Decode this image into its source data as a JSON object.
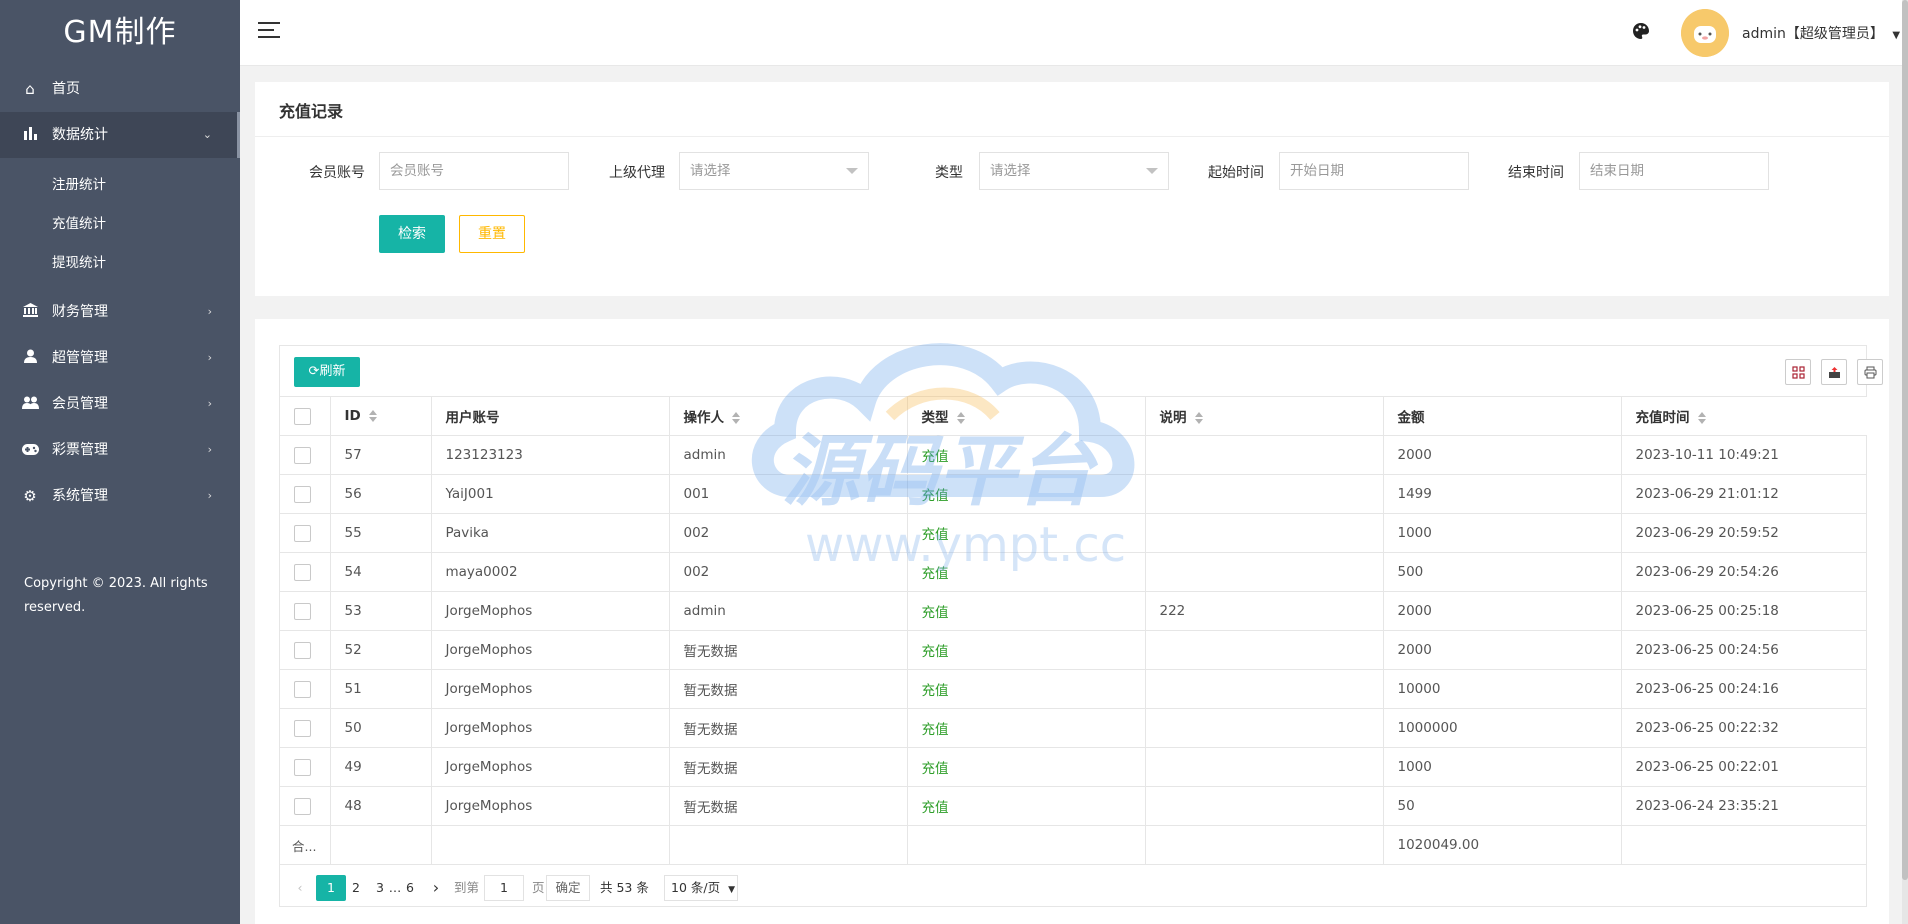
{
  "app": {
    "logo": "GM制作",
    "copyright": "Copyright © 2023. All rights reserved."
  },
  "sidebar": {
    "items": [
      {
        "label": "首页",
        "icon": "home-icon"
      },
      {
        "label": "数据统计",
        "icon": "bar-chart-icon",
        "expanded": true,
        "children": [
          "注册统计",
          "充值统计",
          "提现统计"
        ]
      },
      {
        "label": "财务管理",
        "icon": "bank-icon"
      },
      {
        "label": "超管管理",
        "icon": "user-icon"
      },
      {
        "label": "会员管理",
        "icon": "users-icon"
      },
      {
        "label": "彩票管理",
        "icon": "gamepad-icon"
      },
      {
        "label": "系统管理",
        "icon": "gear-icon"
      }
    ]
  },
  "header": {
    "user": "admin【超级管理员】",
    "icons": [
      "menu-icon",
      "palette-icon",
      "avatar"
    ]
  },
  "filter": {
    "title": "充值记录",
    "fields": [
      {
        "label": "会员账号",
        "placeholder": "会员账号"
      },
      {
        "label": "上级代理",
        "placeholder": "请选择"
      },
      {
        "label": "类型",
        "placeholder": "请选择"
      },
      {
        "label": "起始时间",
        "placeholder": "开始日期"
      },
      {
        "label": "结束时间",
        "placeholder": "结束日期"
      }
    ],
    "search_label": "检索",
    "reset_label": "重置"
  },
  "table": {
    "refresh_label": "刷新",
    "toolbar_icons": [
      "columns-icon",
      "export-icon",
      "print-icon"
    ],
    "columns": [
      "ID",
      "用户账号",
      "操作人",
      "类型",
      "说明",
      "金额",
      "充值时间"
    ],
    "rows": [
      [
        "57",
        "123123123",
        "admin",
        "充值",
        "",
        "2000",
        "2023-10-11 10:49:21"
      ],
      [
        "56",
        "YaiJ001",
        "001",
        "充值",
        "",
        "1499",
        "2023-06-29 21:01:12"
      ],
      [
        "55",
        "Pavika",
        "002",
        "充值",
        "",
        "1000",
        "2023-06-29 20:59:52"
      ],
      [
        "54",
        "maya0002",
        "002",
        "充值",
        "",
        "500",
        "2023-06-29 20:54:26"
      ],
      [
        "53",
        "JorgeMophos",
        "admin",
        "充值",
        "222",
        "2000",
        "2023-06-25 00:25:18"
      ],
      [
        "52",
        "JorgeMophos",
        "暂无数据",
        "充值",
        "",
        "2000",
        "2023-06-25 00:24:56"
      ],
      [
        "51",
        "JorgeMophos",
        "暂无数据",
        "充值",
        "",
        "10000",
        "2023-06-25 00:24:16"
      ],
      [
        "50",
        "JorgeMophos",
        "暂无数据",
        "充值",
        "",
        "1000000",
        "2023-06-25 00:22:32"
      ],
      [
        "49",
        "JorgeMophos",
        "暂无数据",
        "充值",
        "",
        "1000",
        "2023-06-25 00:22:01"
      ],
      [
        "48",
        "JorgeMophos",
        "暂无数据",
        "充值",
        "",
        "50",
        "2023-06-24 23:35:21"
      ]
    ],
    "total_label": "合...",
    "total_amount": "1020049.00"
  },
  "pagination": {
    "pages": [
      "1",
      "2",
      "3",
      "…",
      "6"
    ],
    "current": "1",
    "goto_label": "到第",
    "goto_value": "1",
    "page_unit": "页",
    "confirm_label": "确定",
    "total_text": "共 53 条",
    "page_size": "10 条/页"
  },
  "watermark": {
    "title": "源码平台",
    "url": "www.ympt.cc"
  },
  "colors": {
    "sidebar": "#4a5466",
    "primary": "#16b4a6",
    "warn": "#ffb800",
    "type_text": "#2e9e29"
  }
}
